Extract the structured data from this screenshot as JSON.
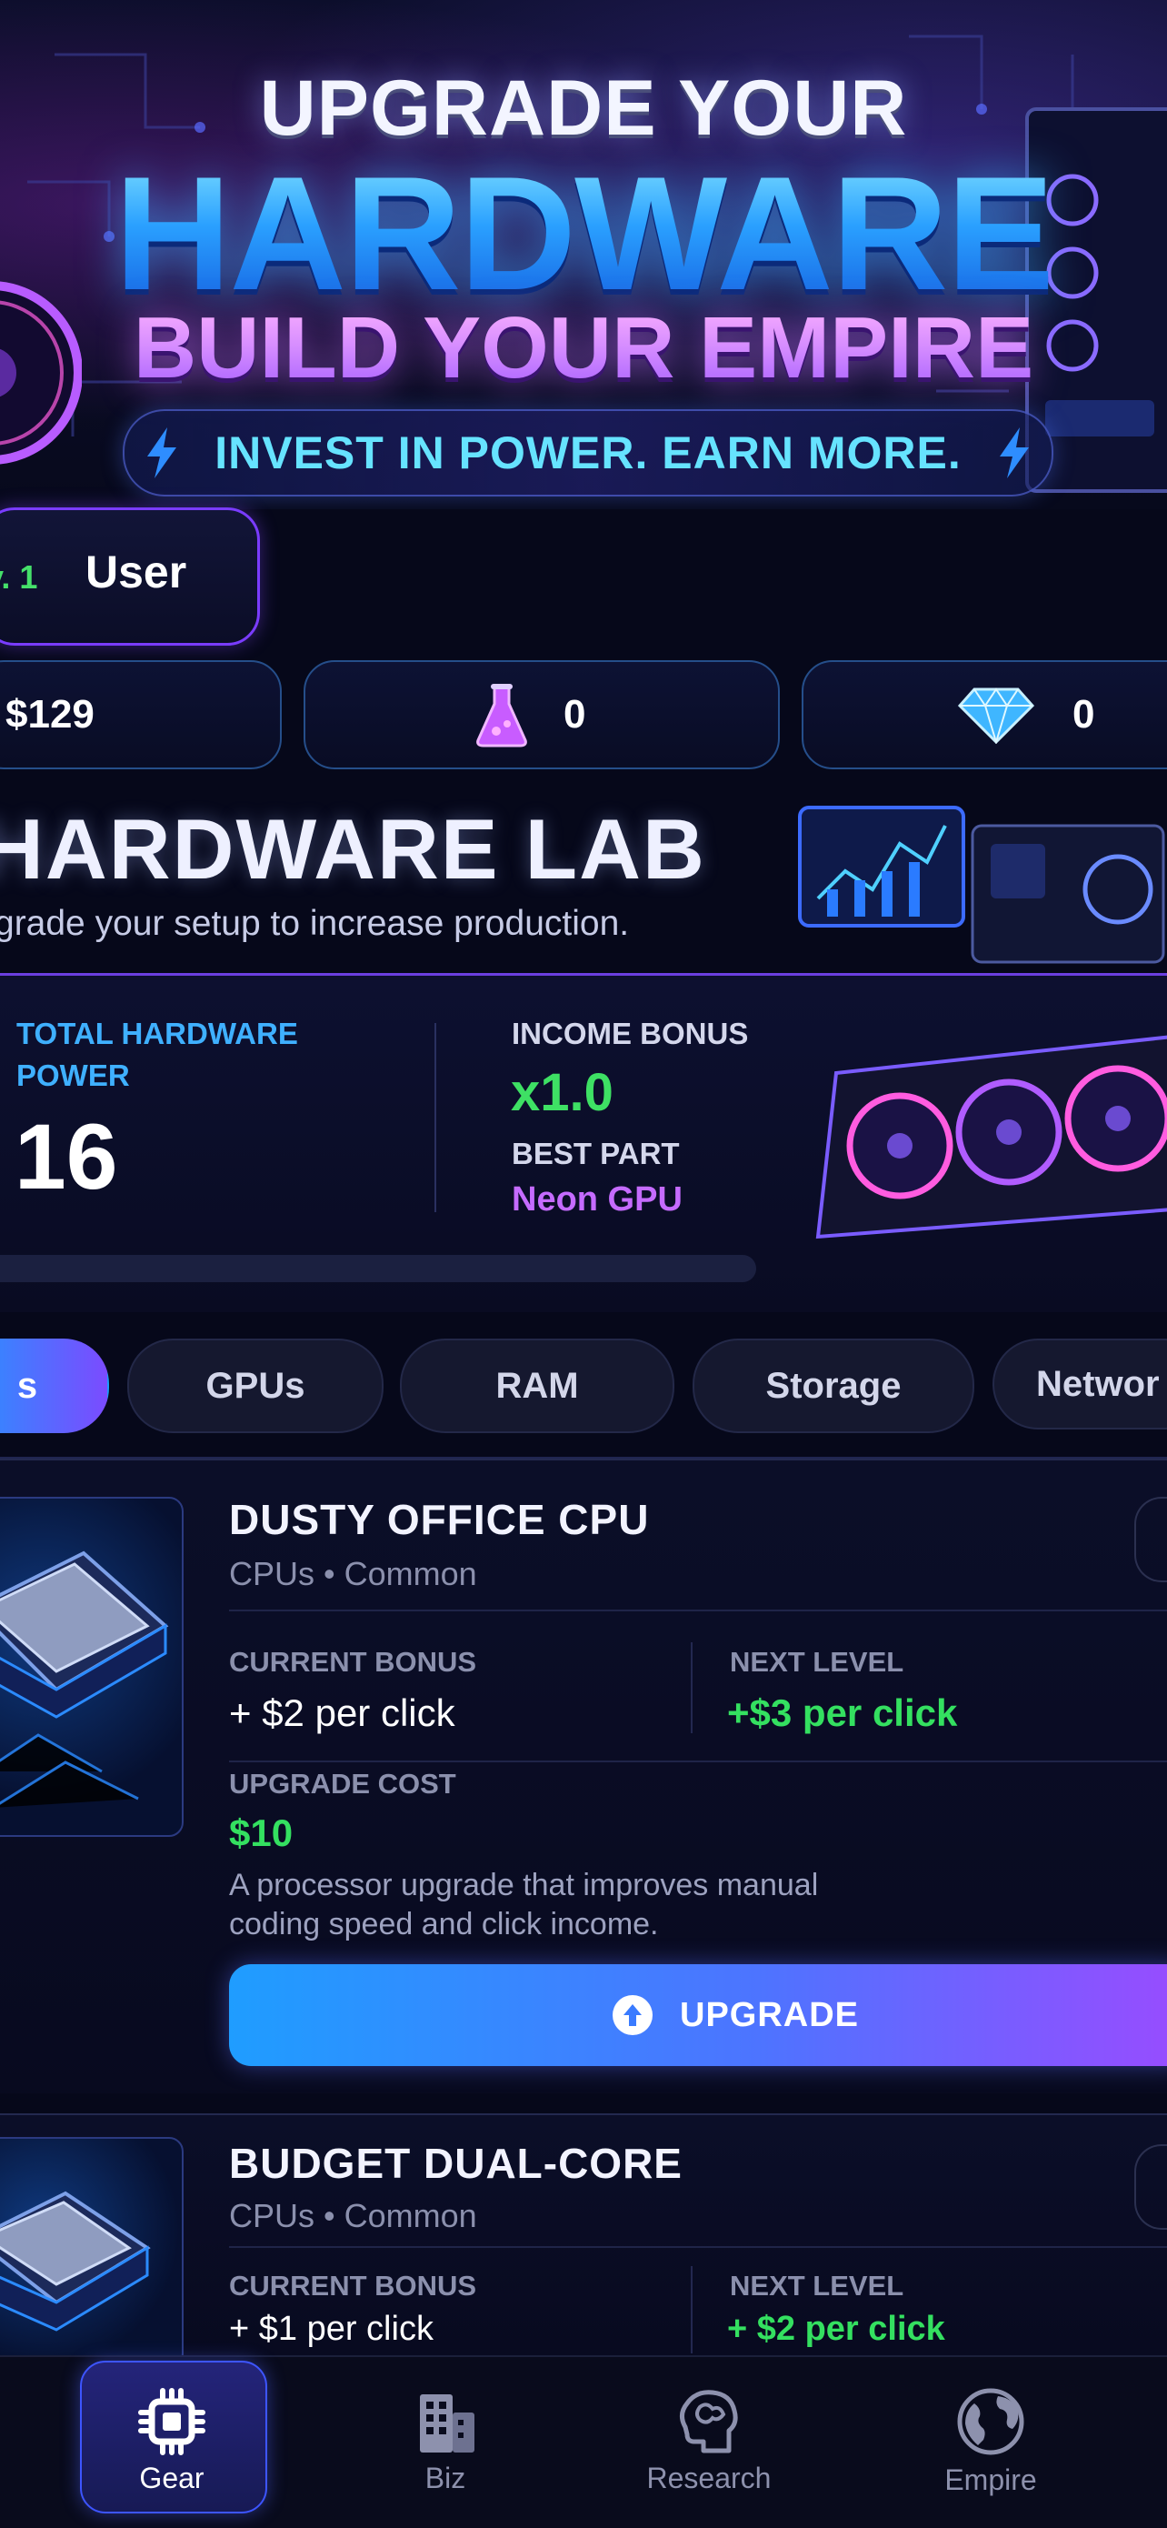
{
  "banner": {
    "line1": "UPGRADE YOUR",
    "line2": "HARDWARE",
    "line3": "BUILD YOUR EMPIRE",
    "tagline": "INVEST IN POWER. EARN MORE."
  },
  "user": {
    "level": "v. 1",
    "name": "User"
  },
  "resources": [
    {
      "icon": "cash-icon",
      "value": "$129"
    },
    {
      "icon": "flask-icon",
      "value": "0"
    },
    {
      "icon": "diamond-icon",
      "value": "0"
    }
  ],
  "lab": {
    "title": "HARDWARE LAB",
    "subtitle": "grade your setup to increase production.",
    "total_power_label": "TOTAL HARDWARE POWER",
    "total_power_label_1": "TOTAL HARDWARE",
    "total_power_label_2": "POWER",
    "total_power_value": "16",
    "income_bonus_label": "INCOME BONUS",
    "income_bonus_value": "x1.0",
    "best_part_label": "BEST PART",
    "best_part_value": "Neon GPU",
    "progress": 0.02
  },
  "tabs": [
    {
      "label": "s",
      "active": true
    },
    {
      "label": "GPUs",
      "active": false
    },
    {
      "label": "RAM",
      "active": false
    },
    {
      "label": "Storage",
      "active": false
    },
    {
      "label": "Networ",
      "active": false
    }
  ],
  "cards": [
    {
      "title": "DUSTY OFFICE CPU",
      "category": "CPUs • Common",
      "current_bonus_label": "CURRENT BONUS",
      "current_bonus": "+ $2 per click",
      "next_level_label": "NEXT LEVEL",
      "next_level": "+$3 per click",
      "upgrade_cost_label": "UPGRADE COST",
      "upgrade_cost": "$10",
      "description_1": "A processor upgrade that improves manual",
      "description_2": "coding speed and click income.",
      "button_label": "UPGRADE"
    },
    {
      "title": "BUDGET DUAL-CORE",
      "category": "CPUs • Common",
      "current_bonus_label": "CURRENT BONUS",
      "current_bonus": "+ $1 per click",
      "next_level_label": "NEXT LEVEL",
      "next_level": "+ $2 per click"
    }
  ],
  "nav": [
    {
      "label": "Gear",
      "icon": "chip-icon",
      "active": true
    },
    {
      "label": "Biz",
      "icon": "building-icon",
      "active": false
    },
    {
      "label": "Research",
      "icon": "brain-icon",
      "active": false
    },
    {
      "label": "Empire",
      "icon": "globe-icon",
      "active": false
    }
  ]
}
